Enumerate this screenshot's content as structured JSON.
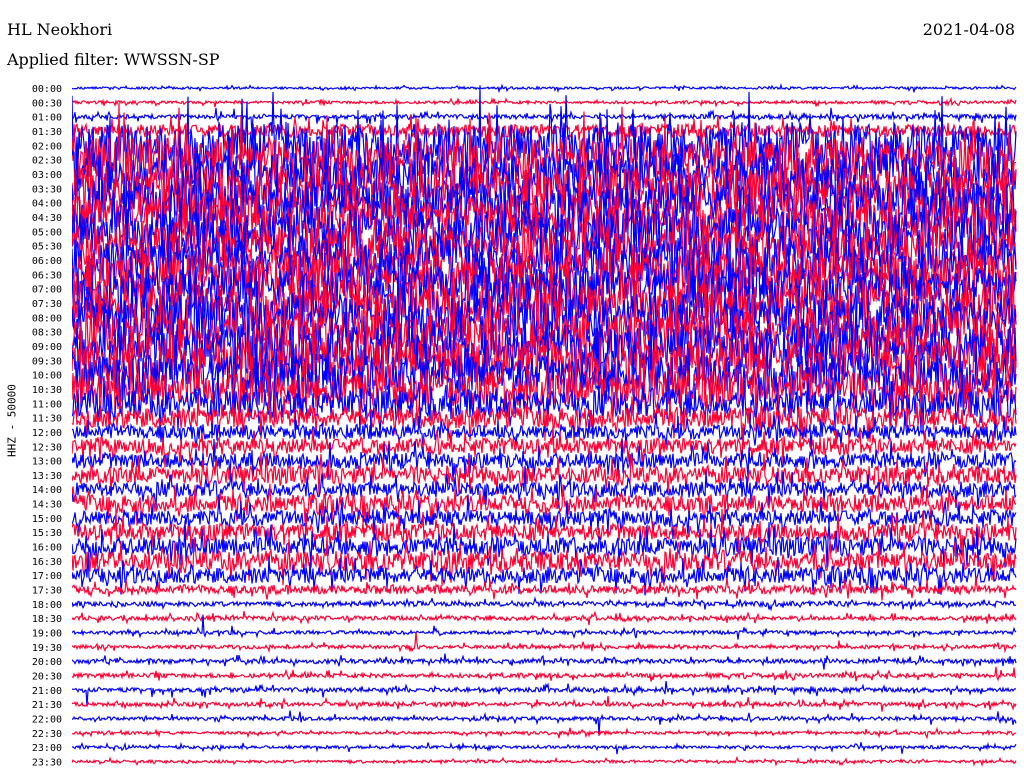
{
  "header": {
    "station": "HL Neokhori",
    "filter": "Applied filter: WWSSN-SP",
    "date": "2021-04-08"
  },
  "chart_data": {
    "type": "line",
    "title": "HL Neokhori",
    "ylabel": "HHZ - 50000",
    "colors": [
      "#0000ff",
      "#ff0033"
    ],
    "rows": [
      "00:00",
      "00:30",
      "01:00",
      "01:30",
      "02:00",
      "02:30",
      "03:00",
      "03:30",
      "04:00",
      "04:30",
      "05:00",
      "05:30",
      "06:00",
      "06:30",
      "07:00",
      "07:30",
      "08:00",
      "08:30",
      "09:00",
      "09:30",
      "10:00",
      "10:30",
      "11:00",
      "11:30",
      "12:00",
      "12:30",
      "13:00",
      "13:30",
      "14:00",
      "14:30",
      "15:00",
      "15:30",
      "16:00",
      "16:30",
      "17:00",
      "17:30",
      "18:00",
      "18:30",
      "19:00",
      "19:30",
      "20:00",
      "20:30",
      "21:00",
      "21:30",
      "22:00",
      "22:30",
      "23:00",
      "23:30"
    ],
    "relative_amplitude": [
      0.15,
      0.2,
      0.3,
      0.9,
      3,
      3,
      3,
      3,
      3,
      3,
      3,
      3,
      3,
      3,
      3,
      3,
      3,
      3,
      3,
      3,
      2.8,
      2.5,
      2,
      1.4,
      1.0,
      1.1,
      1.1,
      1.2,
      1.1,
      1.2,
      1.1,
      1.2,
      1.3,
      1.4,
      1.1,
      0.6,
      0.35,
      0.3,
      0.25,
      0.25,
      0.3,
      0.3,
      0.3,
      0.3,
      0.25,
      0.2,
      0.2,
      0.2
    ]
  }
}
